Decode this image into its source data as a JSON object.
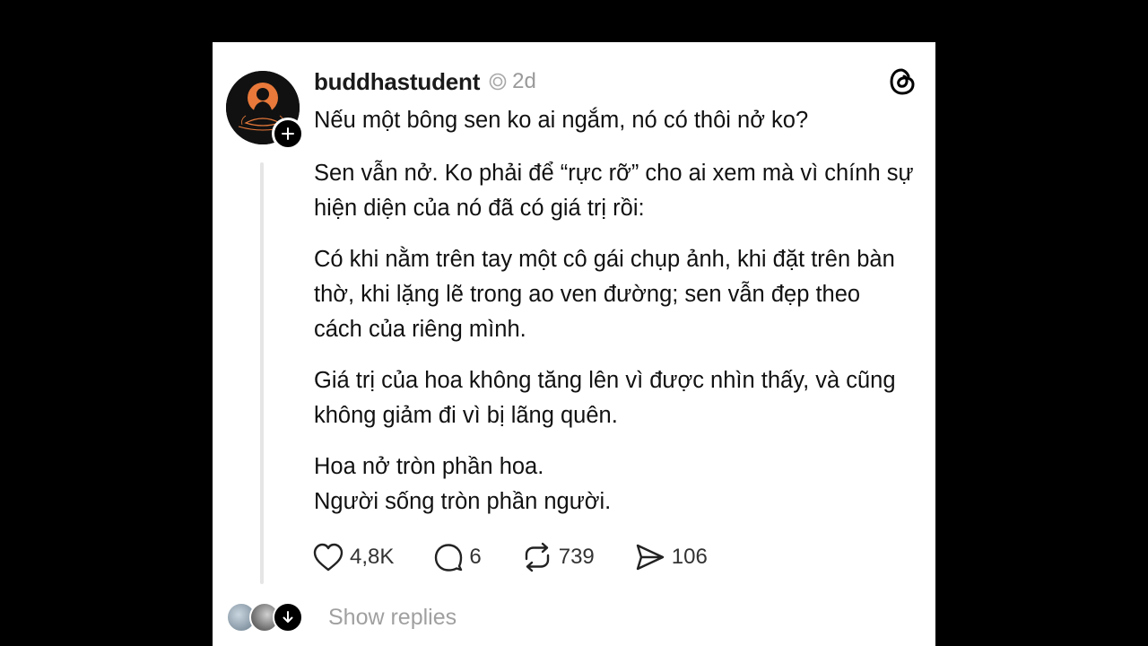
{
  "post": {
    "username": "buddhastudent",
    "time": "2d",
    "paragraphs": [
      "Nếu một bông sen ko ai ngắm, nó có thôi nở ko?",
      "Sen vẫn nở. Ko phải để “rực rỡ” cho ai xem mà vì chính sự hiện diện của nó đã có giá trị rồi:",
      "Có khi nằm trên tay một cô gái chụp ảnh, khi đặt trên bàn thờ, khi lặng lẽ trong ao ven đường; sen vẫn đẹp theo cách của riêng mình.",
      "Giá trị của hoa không tăng lên vì được nhìn thấy, và cũng không giảm đi vì bị lãng quên."
    ],
    "closing_lines": [
      "Hoa nở tròn phần hoa.",
      "Người sống tròn phần người."
    ]
  },
  "actions": {
    "likes": "4,8K",
    "comments": "6",
    "reposts": "739",
    "shares": "106"
  },
  "replies": {
    "label": "Show replies"
  },
  "icons": {
    "logo": "threads-logo-icon",
    "like": "heart-icon",
    "comment": "comment-bubble-icon",
    "repost": "repost-icon",
    "share": "send-icon",
    "badge": "circle-badge-icon",
    "follow": "plus-icon",
    "expand": "arrow-down-icon"
  },
  "colors": {
    "avatar_accent": "#e8793a",
    "background": "#000000",
    "card": "#ffffff",
    "muted_text": "#9a9a9a"
  }
}
